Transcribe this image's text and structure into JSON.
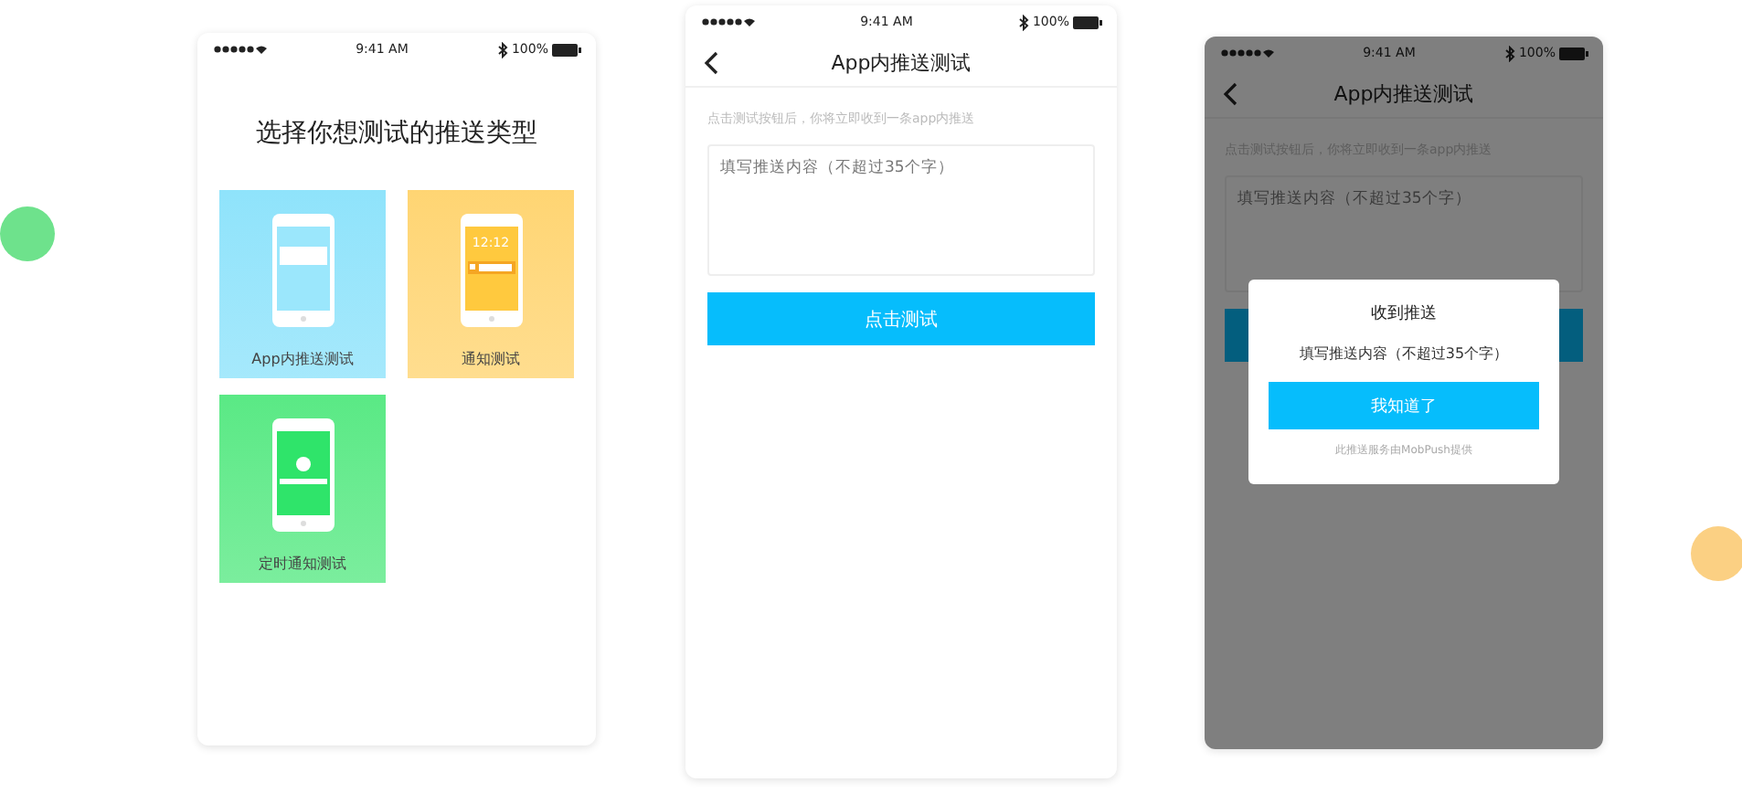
{
  "screens": [
    {
      "kind": "menu",
      "status": {
        "time": "9:41 AM",
        "battery": "100%"
      },
      "title": "选择你想测试的推送类型",
      "options": [
        {
          "kind": "inapp",
          "label": "App内推送测试",
          "color": "#8fe3fb"
        },
        {
          "kind": "notify",
          "label": "通知测试",
          "color": "#ffd573",
          "clock": "12:12"
        },
        {
          "kind": "timed",
          "label": "定时通知测试",
          "color": "#5ae985"
        }
      ]
    },
    {
      "kind": "form",
      "dimmed": false,
      "status": {
        "time": "9:41 AM",
        "battery": "100%"
      },
      "nav_title": "App内推送测试",
      "hint": "点击测试按钮后，你将立即收到一条app内推送",
      "placeholder": "填写推送内容（不超过35个字）",
      "button": "点击测试"
    },
    {
      "kind": "form",
      "dimmed": true,
      "status": {
        "time": "9:41 AM",
        "battery": "100%"
      },
      "nav_title": "App内推送测试",
      "hint": "点击测试按钮后，你将立即收到一条app内推送",
      "placeholder": "填写推送内容（不超过35个字）",
      "dialog": {
        "title": "收到推送",
        "message": "填写推送内容（不超过35个字）",
        "button": "我知道了",
        "footer": "此推送服务由MobPush提供"
      }
    }
  ]
}
